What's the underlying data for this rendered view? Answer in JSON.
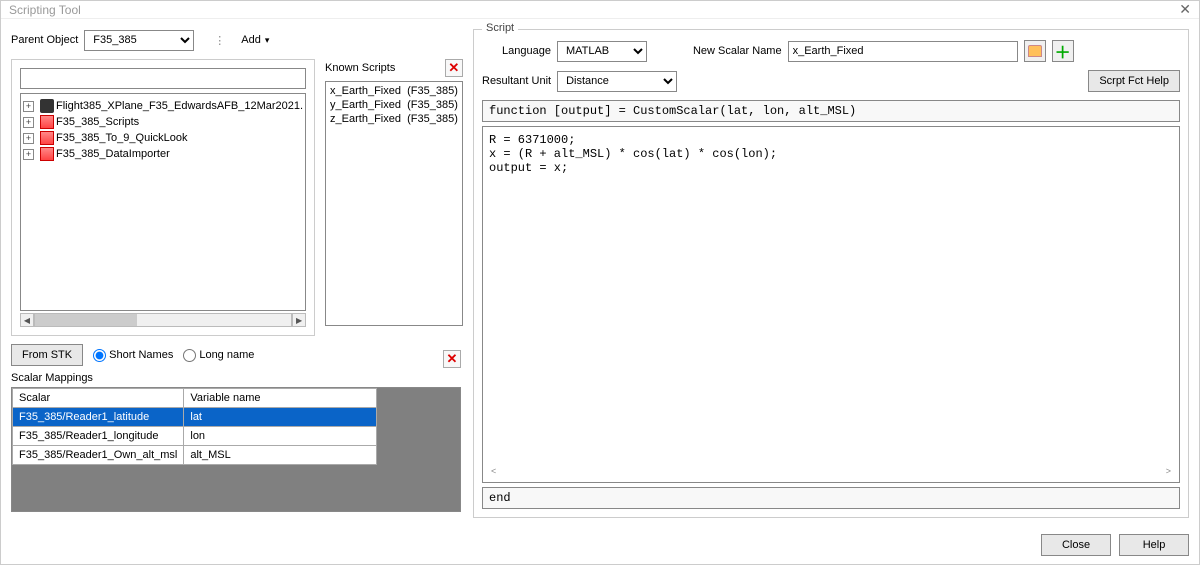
{
  "window": {
    "title": "Scripting Tool"
  },
  "parent": {
    "label": "Parent Object",
    "value": "F35_385"
  },
  "add": {
    "label": "Add"
  },
  "tree": {
    "items": [
      {
        "name": "Flight385_XPlane_F35_EdwardsAFB_12Mar2021.",
        "icon": "plane"
      },
      {
        "name": "F35_385_Scripts",
        "icon": "doc"
      },
      {
        "name": "F35_385_To_9_QuickLook",
        "icon": "doc"
      },
      {
        "name": "F35_385_DataImporter",
        "icon": "doc"
      }
    ]
  },
  "known": {
    "label": "Known Scripts",
    "items": [
      {
        "name": "x_Earth_Fixed",
        "parent": "(F35_385)"
      },
      {
        "name": "y_Earth_Fixed",
        "parent": "(F35_385)"
      },
      {
        "name": "z_Earth_Fixed",
        "parent": "(F35_385)"
      }
    ]
  },
  "below": {
    "from_stk": "From STK",
    "short": "Short Names",
    "long": "Long name"
  },
  "mappings": {
    "label": "Scalar Mappings",
    "headers": {
      "scalar": "Scalar",
      "var": "Variable name"
    },
    "rows": [
      {
        "scalar": "F35_385/Reader1_latitude",
        "var": "lat",
        "selected": true
      },
      {
        "scalar": "F35_385/Reader1_longitude",
        "var": "lon",
        "selected": false
      },
      {
        "scalar": "F35_385/Reader1_Own_alt_msl",
        "var": "alt_MSL",
        "selected": false
      }
    ]
  },
  "script": {
    "group": "Script",
    "lang_label": "Language",
    "lang_value": "MATLAB",
    "name_label": "New Scalar Name",
    "name_value": "x_Earth_Fixed",
    "unit_label": "Resultant Unit",
    "unit_value": "Distance",
    "help_btn": "Scrpt Fct Help",
    "fn_decl": "function [output] = CustomScalar(lat, lon, alt_MSL)",
    "body": "R = 6371000;\nx = (R + alt_MSL) * cos(lat) * cos(lon);\noutput = x;",
    "end": "end"
  },
  "footer": {
    "close": "Close",
    "help": "Help"
  }
}
